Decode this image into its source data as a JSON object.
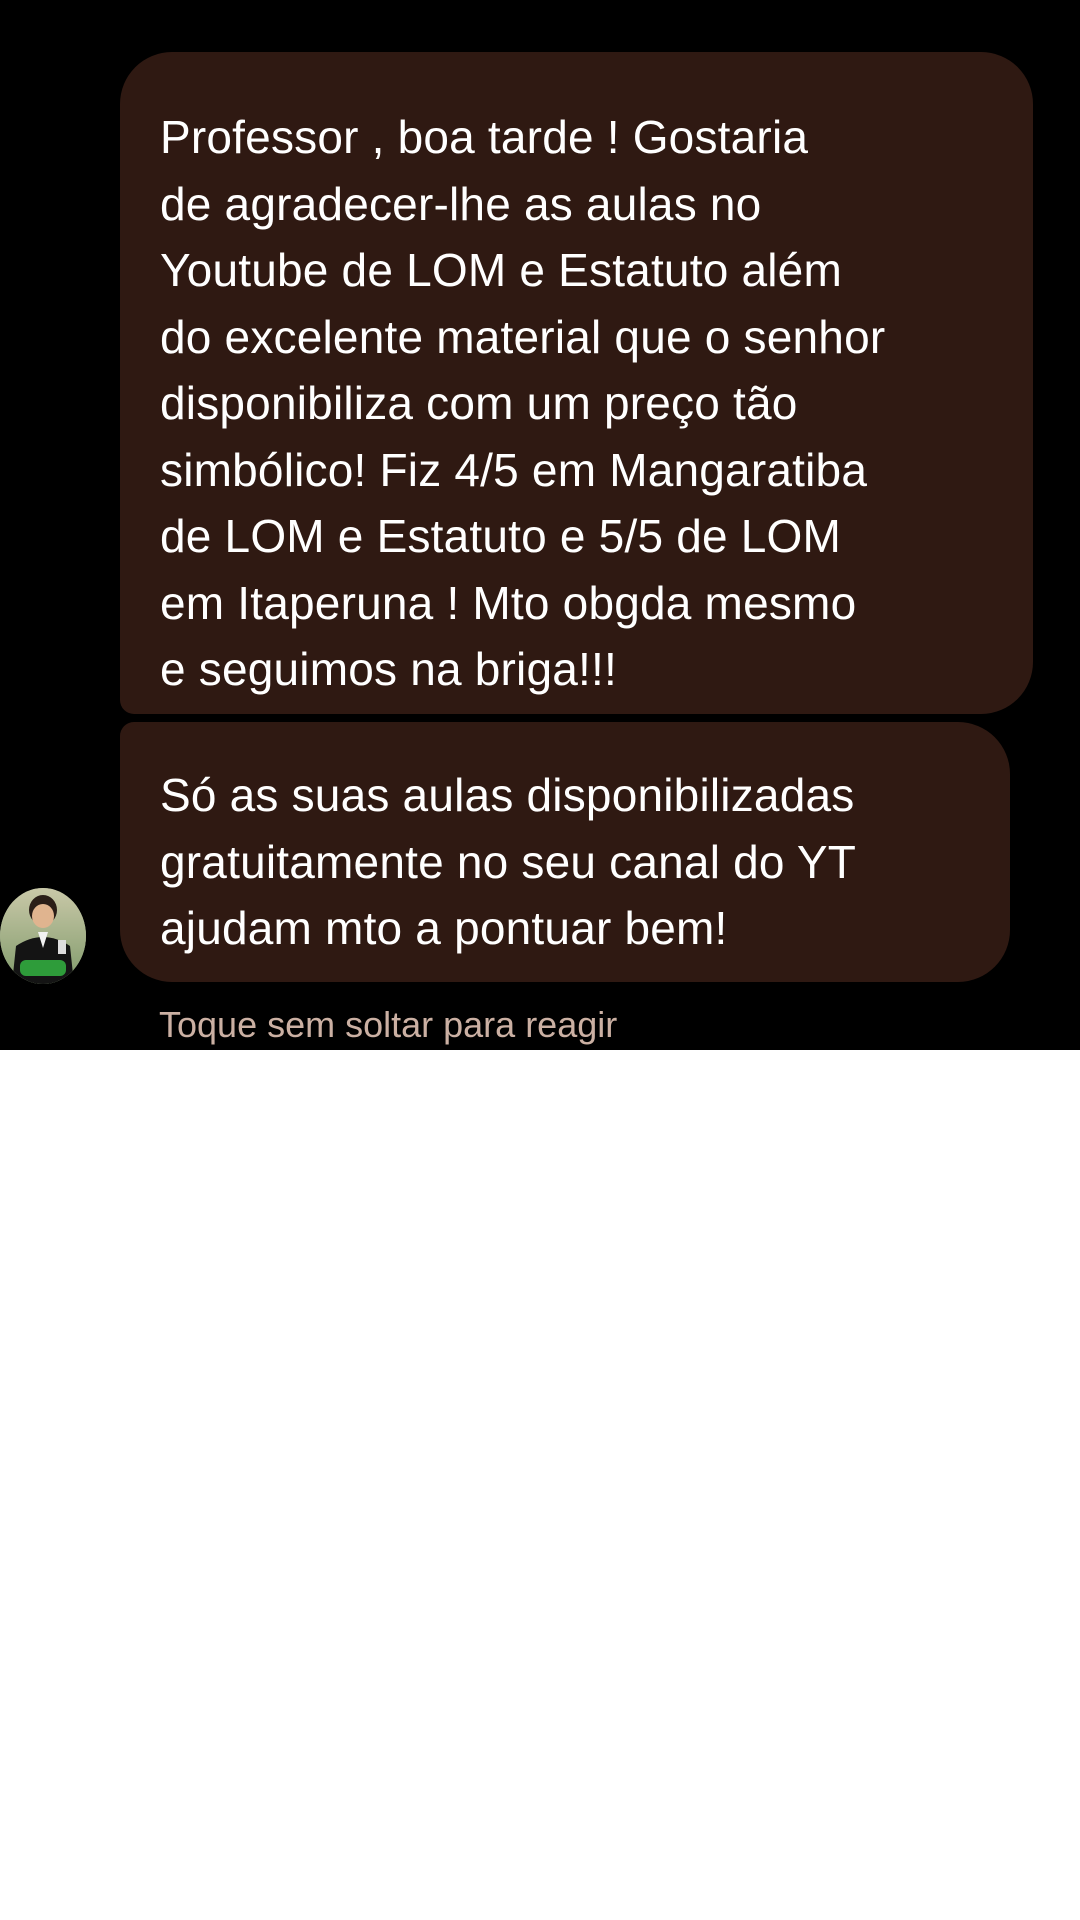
{
  "messages": [
    {
      "text": "Professor , boa tarde ! Gostaria\nde agradecer-lhe as aulas no\nYoutube de LOM e Estatuto além\ndo excelente material que o senhor\ndisponibiliza com um preço tão\nsimbólico! Fiz 4/5 em Mangaratiba\nde LOM e Estatuto e 5/5 de LOM\nem Itaperuna ! Mto obgda mesmo\ne seguimos na briga!!!"
    },
    {
      "text": "Só as suas aulas disponibilizadas\ngratuitamente no seu canal do YT\najudam mto a pontuar bem!"
    }
  ],
  "hint": "Toque sem soltar para reagir",
  "colors": {
    "background": "#000000",
    "bubble": "#2f1912",
    "text": "#ffffff",
    "hint": "#cbb0a3"
  },
  "icons": {
    "avatar": "sender-avatar-photo"
  }
}
